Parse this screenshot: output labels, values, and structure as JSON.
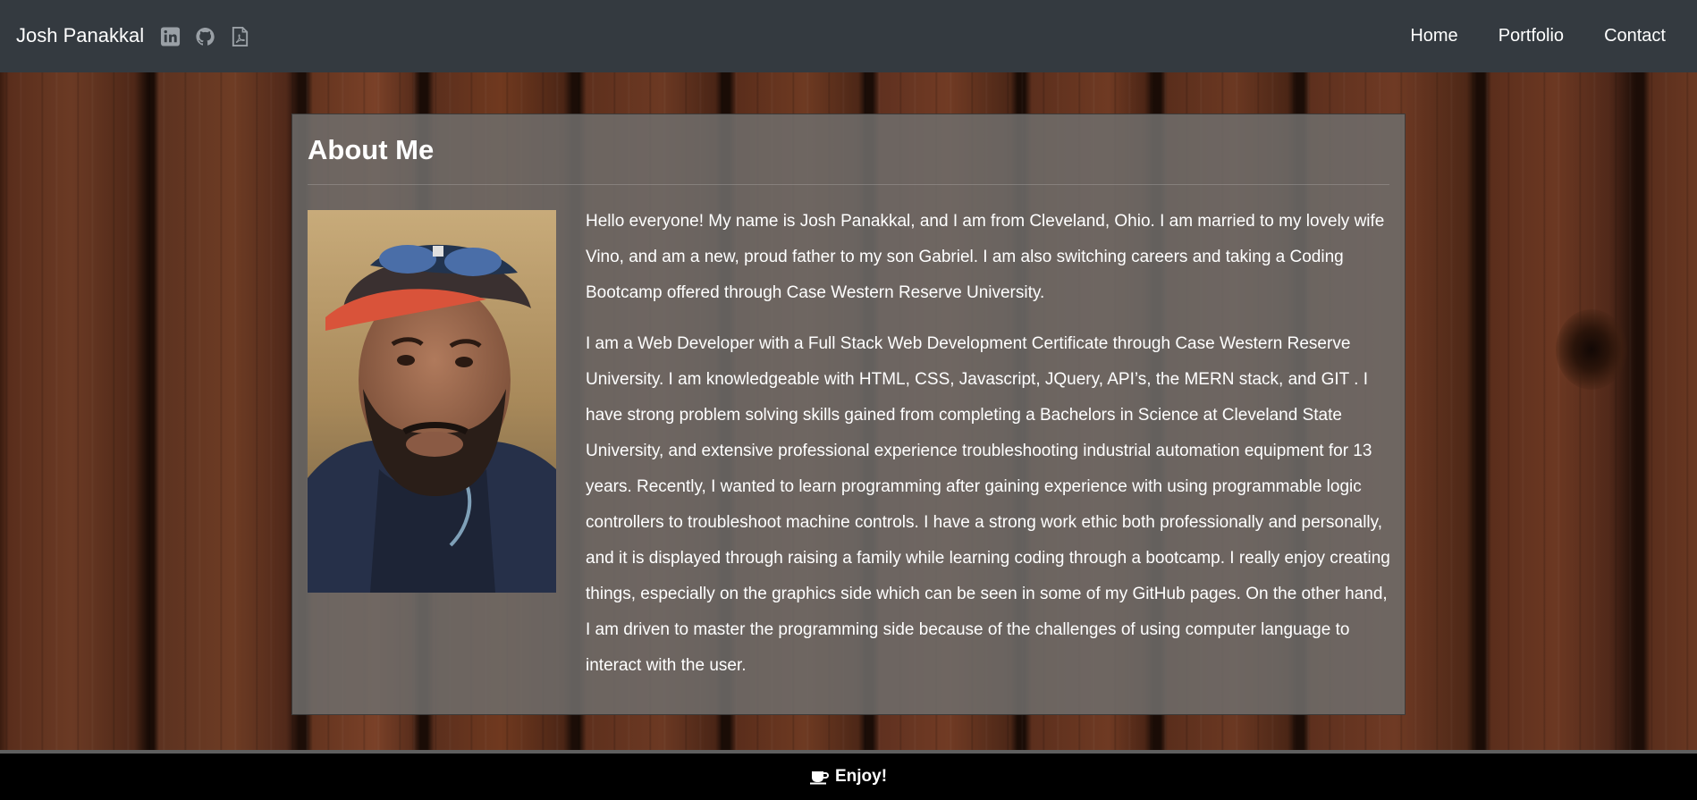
{
  "navbar": {
    "brand": "Josh Panakkal",
    "social": [
      {
        "icon": "linkedin-icon"
      },
      {
        "icon": "github-icon"
      },
      {
        "icon": "pdf-file-icon"
      }
    ],
    "links": [
      {
        "label": "Home"
      },
      {
        "label": "Portfolio"
      },
      {
        "label": "Contact"
      }
    ],
    "background_color": "#343a40"
  },
  "about": {
    "title": "About Me",
    "paragraphs": [
      "Hello everyone! My name is Josh Panakkal, and I am from Cleveland, Ohio. I am married to my lovely wife Vino, and am a new, proud father to my son Gabriel. I am also switching careers and taking a Coding Bootcamp offered through Case Western Reserve University.",
      "I am a Web Developer with a Full Stack Web Development Certificate through Case Western Reserve University. I am knowledgeable with HTML, CSS, Javascript, JQuery, API’s, the MERN stack, and GIT . I have strong problem solving skills gained from completing a Bachelors in Science at Cleveland State University, and extensive professional experience troubleshooting industrial automation equipment for 13 years. Recently, I wanted to learn programming after gaining experience with using programmable logic controllers to troubleshoot machine controls. I have a strong work ethic both professionally and personally, and it is displayed through raising a family while learning coding through a bootcamp. I really enjoy creating things, especially on the graphics side which can be seen in some of my GitHub pages. On the other hand, I am driven to master the programming side because of the challenges of using computer language to interact with the user."
    ]
  },
  "footer": {
    "text": "Enjoy!",
    "icon": "coffee-cup-icon",
    "background_color": "#000000"
  }
}
